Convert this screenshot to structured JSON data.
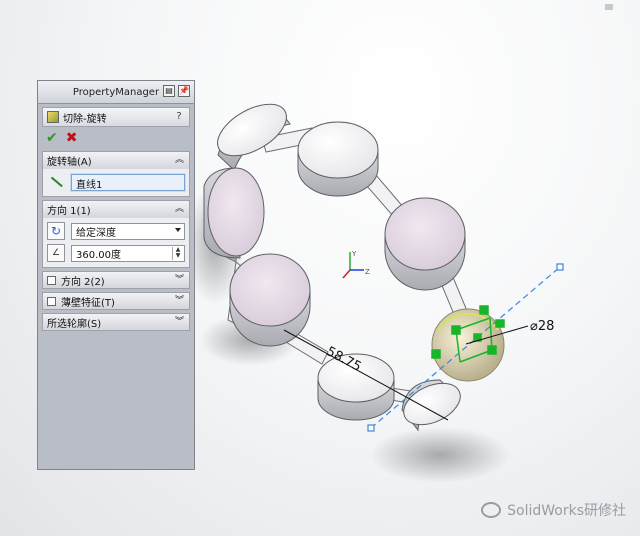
{
  "property_manager": {
    "title": "PropertyManager",
    "feature_name": "切除-旋转",
    "help_label": "?",
    "rotation_axis": {
      "heading": "旋转轴(A)",
      "axis_value": "直线1"
    },
    "direction1": {
      "heading": "方向 1(1)",
      "end_condition": "给定深度",
      "angle_value": "360.00度"
    },
    "direction2": {
      "heading": "方向 2(2)"
    },
    "thin_feature": {
      "heading": "薄壁特征(T)"
    },
    "selected_contours": {
      "heading": "所选轮廓(S)"
    }
  },
  "viewport": {
    "dimension_diameter": "⌀28",
    "dimension_length": "58.75",
    "watermark": "SolidWorks研修社",
    "triad_labels": {
      "y": "Y",
      "z": "Z"
    }
  },
  "colors": {
    "accent_ok": "#2c9a1e",
    "cancel": "#c0121a",
    "sketch_green": "#18b42a",
    "axis_blue": "#3d86d6"
  }
}
